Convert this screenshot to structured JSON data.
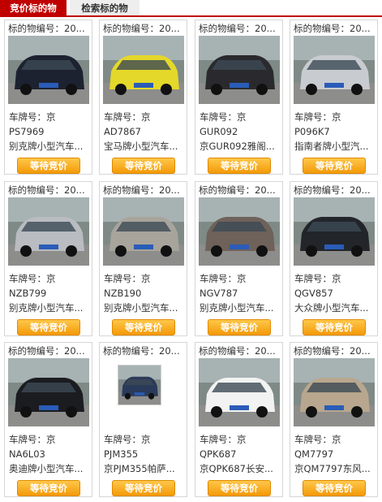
{
  "tabs": {
    "active": "竞价标的物",
    "inactive": "检索标的物"
  },
  "cards": [
    {
      "code": "标的物编号：20...",
      "plate_label": "车牌号：京",
      "plate": "PS7969",
      "desc": "别克牌小型汽车...",
      "button": "等待竞价",
      "car_color": "#1d2230"
    },
    {
      "code": "标的物编号：20...",
      "plate_label": "车牌号：京",
      "plate": "AD7867",
      "desc": "宝马牌小型汽车...",
      "button": "等待竞价",
      "car_color": "#e4d82a"
    },
    {
      "code": "标的物编号：20...",
      "plate_label": "车牌号：京",
      "plate": "GUR092",
      "desc": "京GUR092雅阁...",
      "button": "等待竞价",
      "car_color": "#2a2a2e"
    },
    {
      "code": "标的物编号：20...",
      "plate_label": "车牌号：京",
      "plate": "P096K7",
      "desc": "指南者牌小型汽...",
      "button": "等待竞价",
      "car_color": "#c8ccd0"
    },
    {
      "code": "标的物编号：20...",
      "plate_label": "车牌号：京",
      "plate": "NZB799",
      "desc": "别克牌小型汽车...",
      "button": "等待竞价",
      "car_color": "#b9bcc0"
    },
    {
      "code": "标的物编号：20...",
      "plate_label": "车牌号：京",
      "plate": "NZB190",
      "desc": "别克牌小型汽车...",
      "button": "等待竞价",
      "car_color": "#a8a49c"
    },
    {
      "code": "标的物编号：20...",
      "plate_label": "车牌号：京",
      "plate": "NGV787",
      "desc": "别克牌小型汽车...",
      "button": "等待竞价",
      "car_color": "#6e625a"
    },
    {
      "code": "标的物编号：20...",
      "plate_label": "车牌号：京",
      "plate": "QGV857",
      "desc": "大众牌小型汽车...",
      "button": "等待竞价",
      "car_color": "#22252a"
    },
    {
      "code": "标的物编号：20...",
      "plate_label": "车牌号：京",
      "plate": "NA6L03",
      "desc": "奥迪牌小型汽车...",
      "button": "等待竞价",
      "car_color": "#1b1c20"
    },
    {
      "code": "标的物编号：20...",
      "plate_label": "车牌号：京",
      "plate": "PJM355",
      "desc": "京PJM355帕萨...",
      "button": "等待竞价",
      "car_color": "#2a3a5a"
    },
    {
      "code": "标的物编号：20...",
      "plate_label": "车牌号：京",
      "plate": "QPK687",
      "desc": "京QPK687长安...",
      "button": "等待竞价",
      "car_color": "#f2f2f2"
    },
    {
      "code": "标的物编号：20...",
      "plate_label": "车牌号：京",
      "plate": "QM7797",
      "desc": "京QM7797东风...",
      "button": "等待竞价",
      "car_color": "#b8a78e"
    }
  ]
}
